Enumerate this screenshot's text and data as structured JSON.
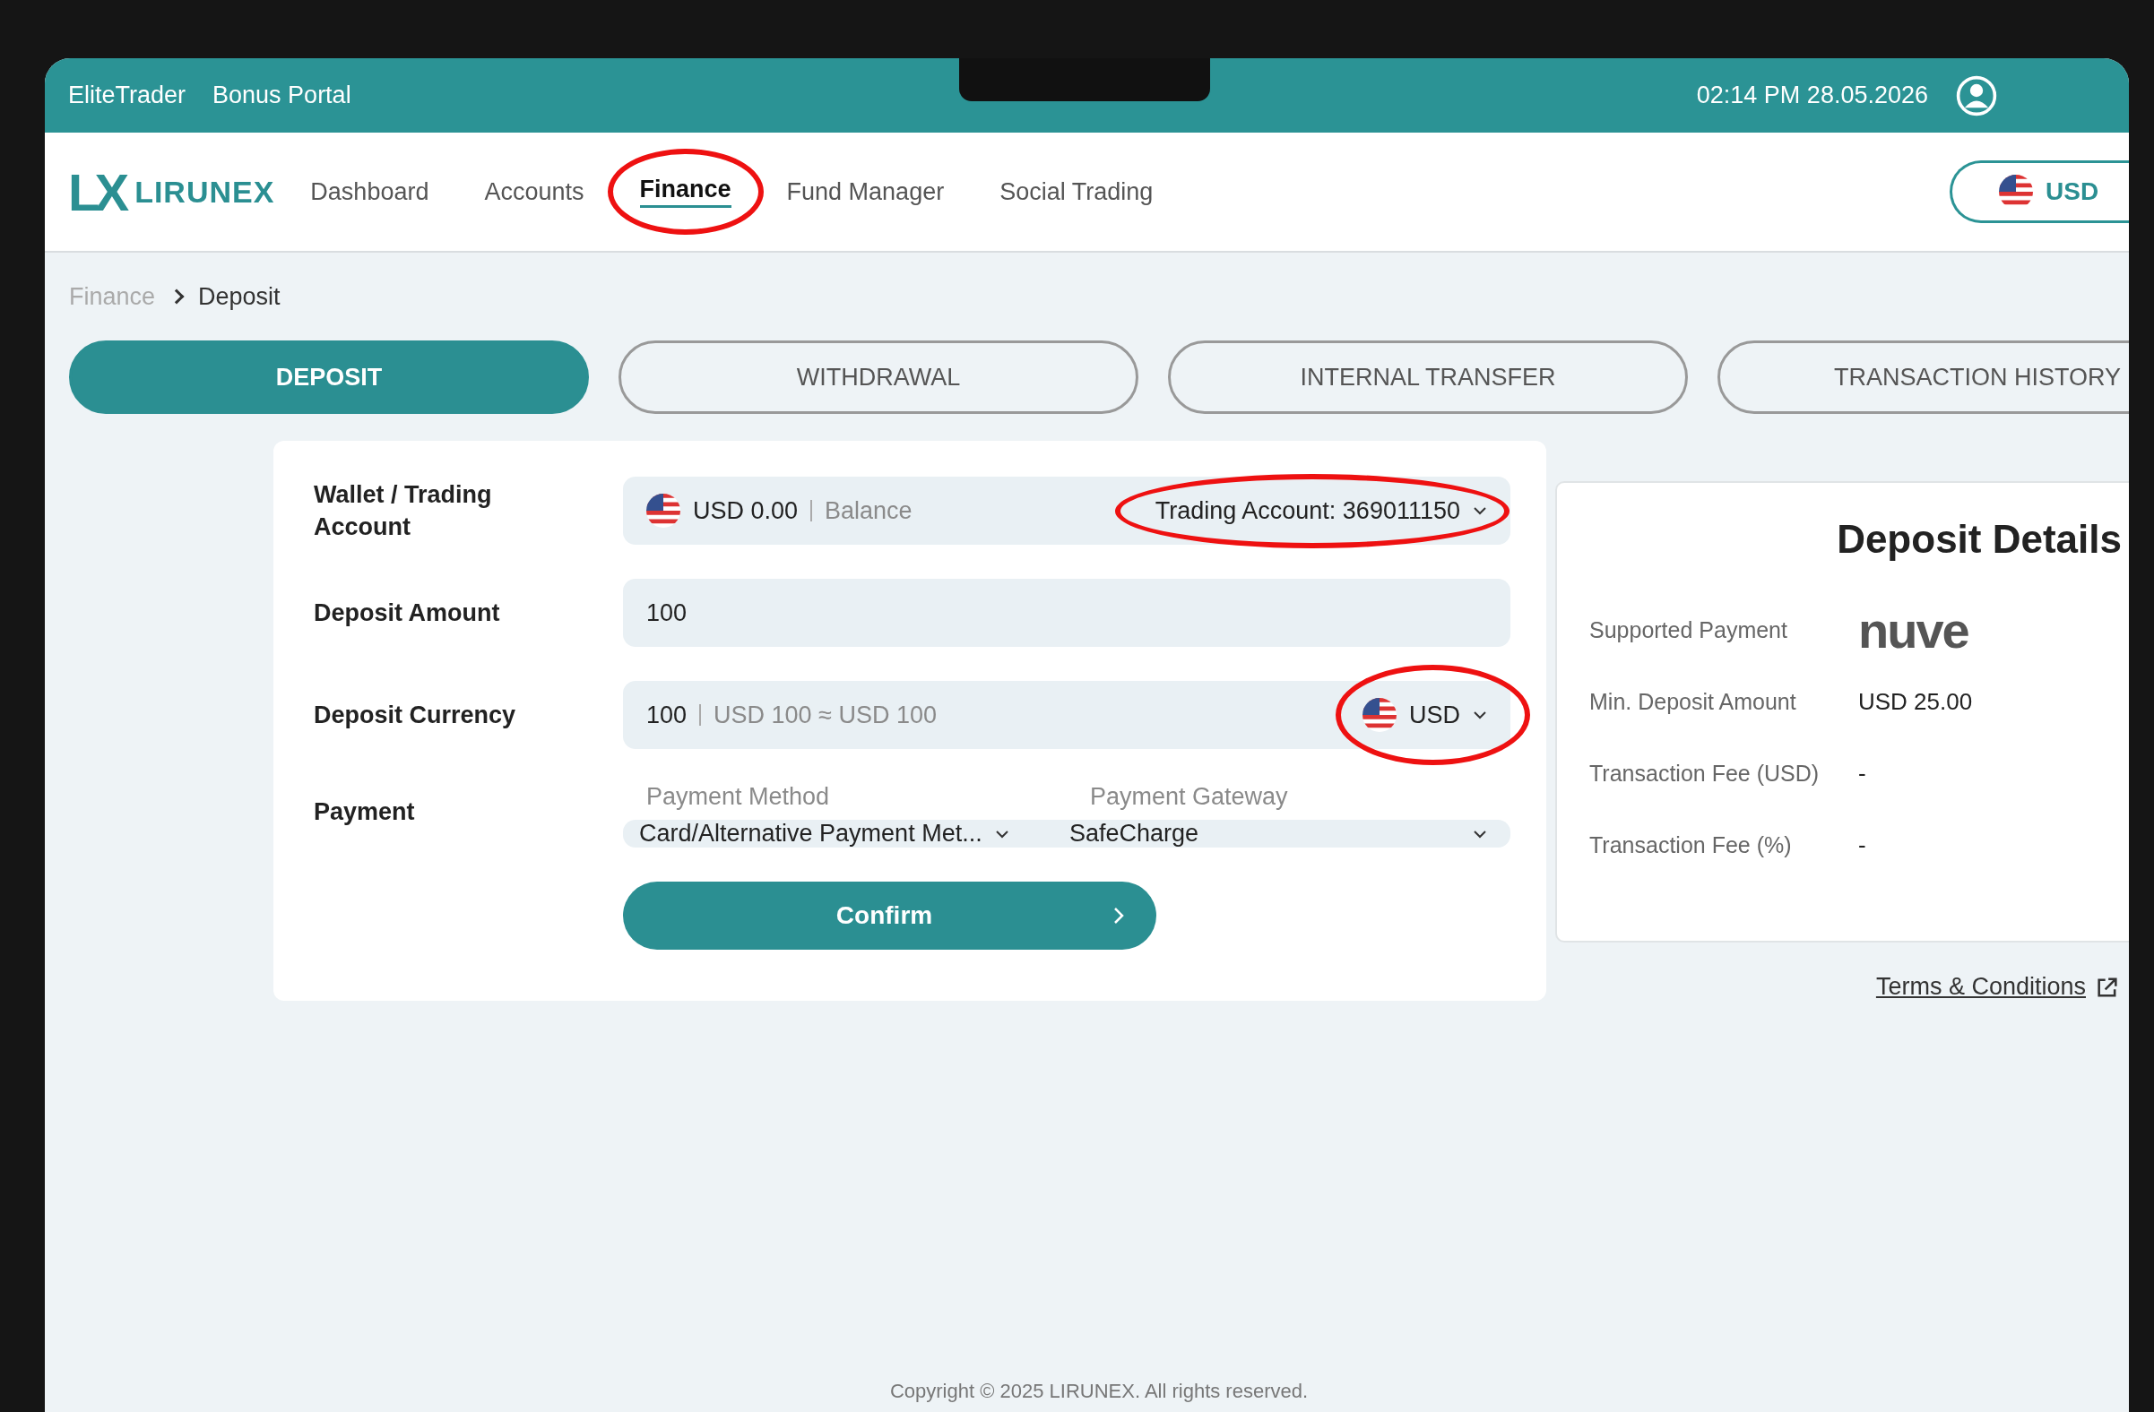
{
  "top_bar": {
    "brand": "EliteTrader",
    "portal": "Bonus Portal",
    "datetime": "02:14 PM 28.05.2026"
  },
  "nav": {
    "logo_mark": "LX",
    "logo": "LIRUNEX",
    "items": [
      {
        "label": "Dashboard",
        "selected": false,
        "circled": false
      },
      {
        "label": "Accounts",
        "selected": false,
        "circled": false
      },
      {
        "label": "Finance",
        "selected": true,
        "circled": true
      },
      {
        "label": "Fund Manager",
        "selected": false,
        "circled": false
      },
      {
        "label": "Social Trading",
        "selected": false,
        "circled": false
      }
    ],
    "currency": "USD"
  },
  "breadcrumb": [
    "Finance",
    "Deposit"
  ],
  "tabs": [
    {
      "label": "DEPOSIT",
      "selected": true
    },
    {
      "label": "WITHDRAWAL",
      "selected": false
    },
    {
      "label": "INTERNAL TRANSFER",
      "selected": false
    },
    {
      "label": "TRANSACTION HISTORY",
      "selected": false
    }
  ],
  "form": {
    "wallet": {
      "label": "Wallet / Trading Account",
      "balance": "USD 0.00",
      "balance_label": "Balance",
      "account": "Trading Account: 369011150",
      "circled": true
    },
    "amount": {
      "label": "Deposit Amount",
      "value": "100"
    },
    "currency": {
      "label": "Deposit Currency",
      "amount": "100",
      "conversion": "USD 100 ≈ USD 100",
      "currency": "USD",
      "circled": true
    },
    "payment": {
      "label": "Payment",
      "method_label": "Payment Method",
      "method": "Card/Alternative Payment Met...",
      "gateway_label": "Payment Gateway",
      "gateway": "SafeCharge"
    },
    "confirm": "Confirm"
  },
  "details": {
    "title": "Deposit Details",
    "rows": [
      {
        "label": "Supported Payment",
        "kind": "logo",
        "value": "nuve"
      },
      {
        "label": "Min. Deposit Amount",
        "kind": "text",
        "value": "USD 25.00"
      },
      {
        "label": "Transaction Fee (USD)",
        "kind": "text",
        "value": "-"
      },
      {
        "label": "Transaction Fee (%)",
        "kind": "text",
        "value": "-"
      }
    ]
  },
  "terms": "Terms & Conditions",
  "footer": "Copyright © 2025 LIRUNEX. All rights reserved."
}
